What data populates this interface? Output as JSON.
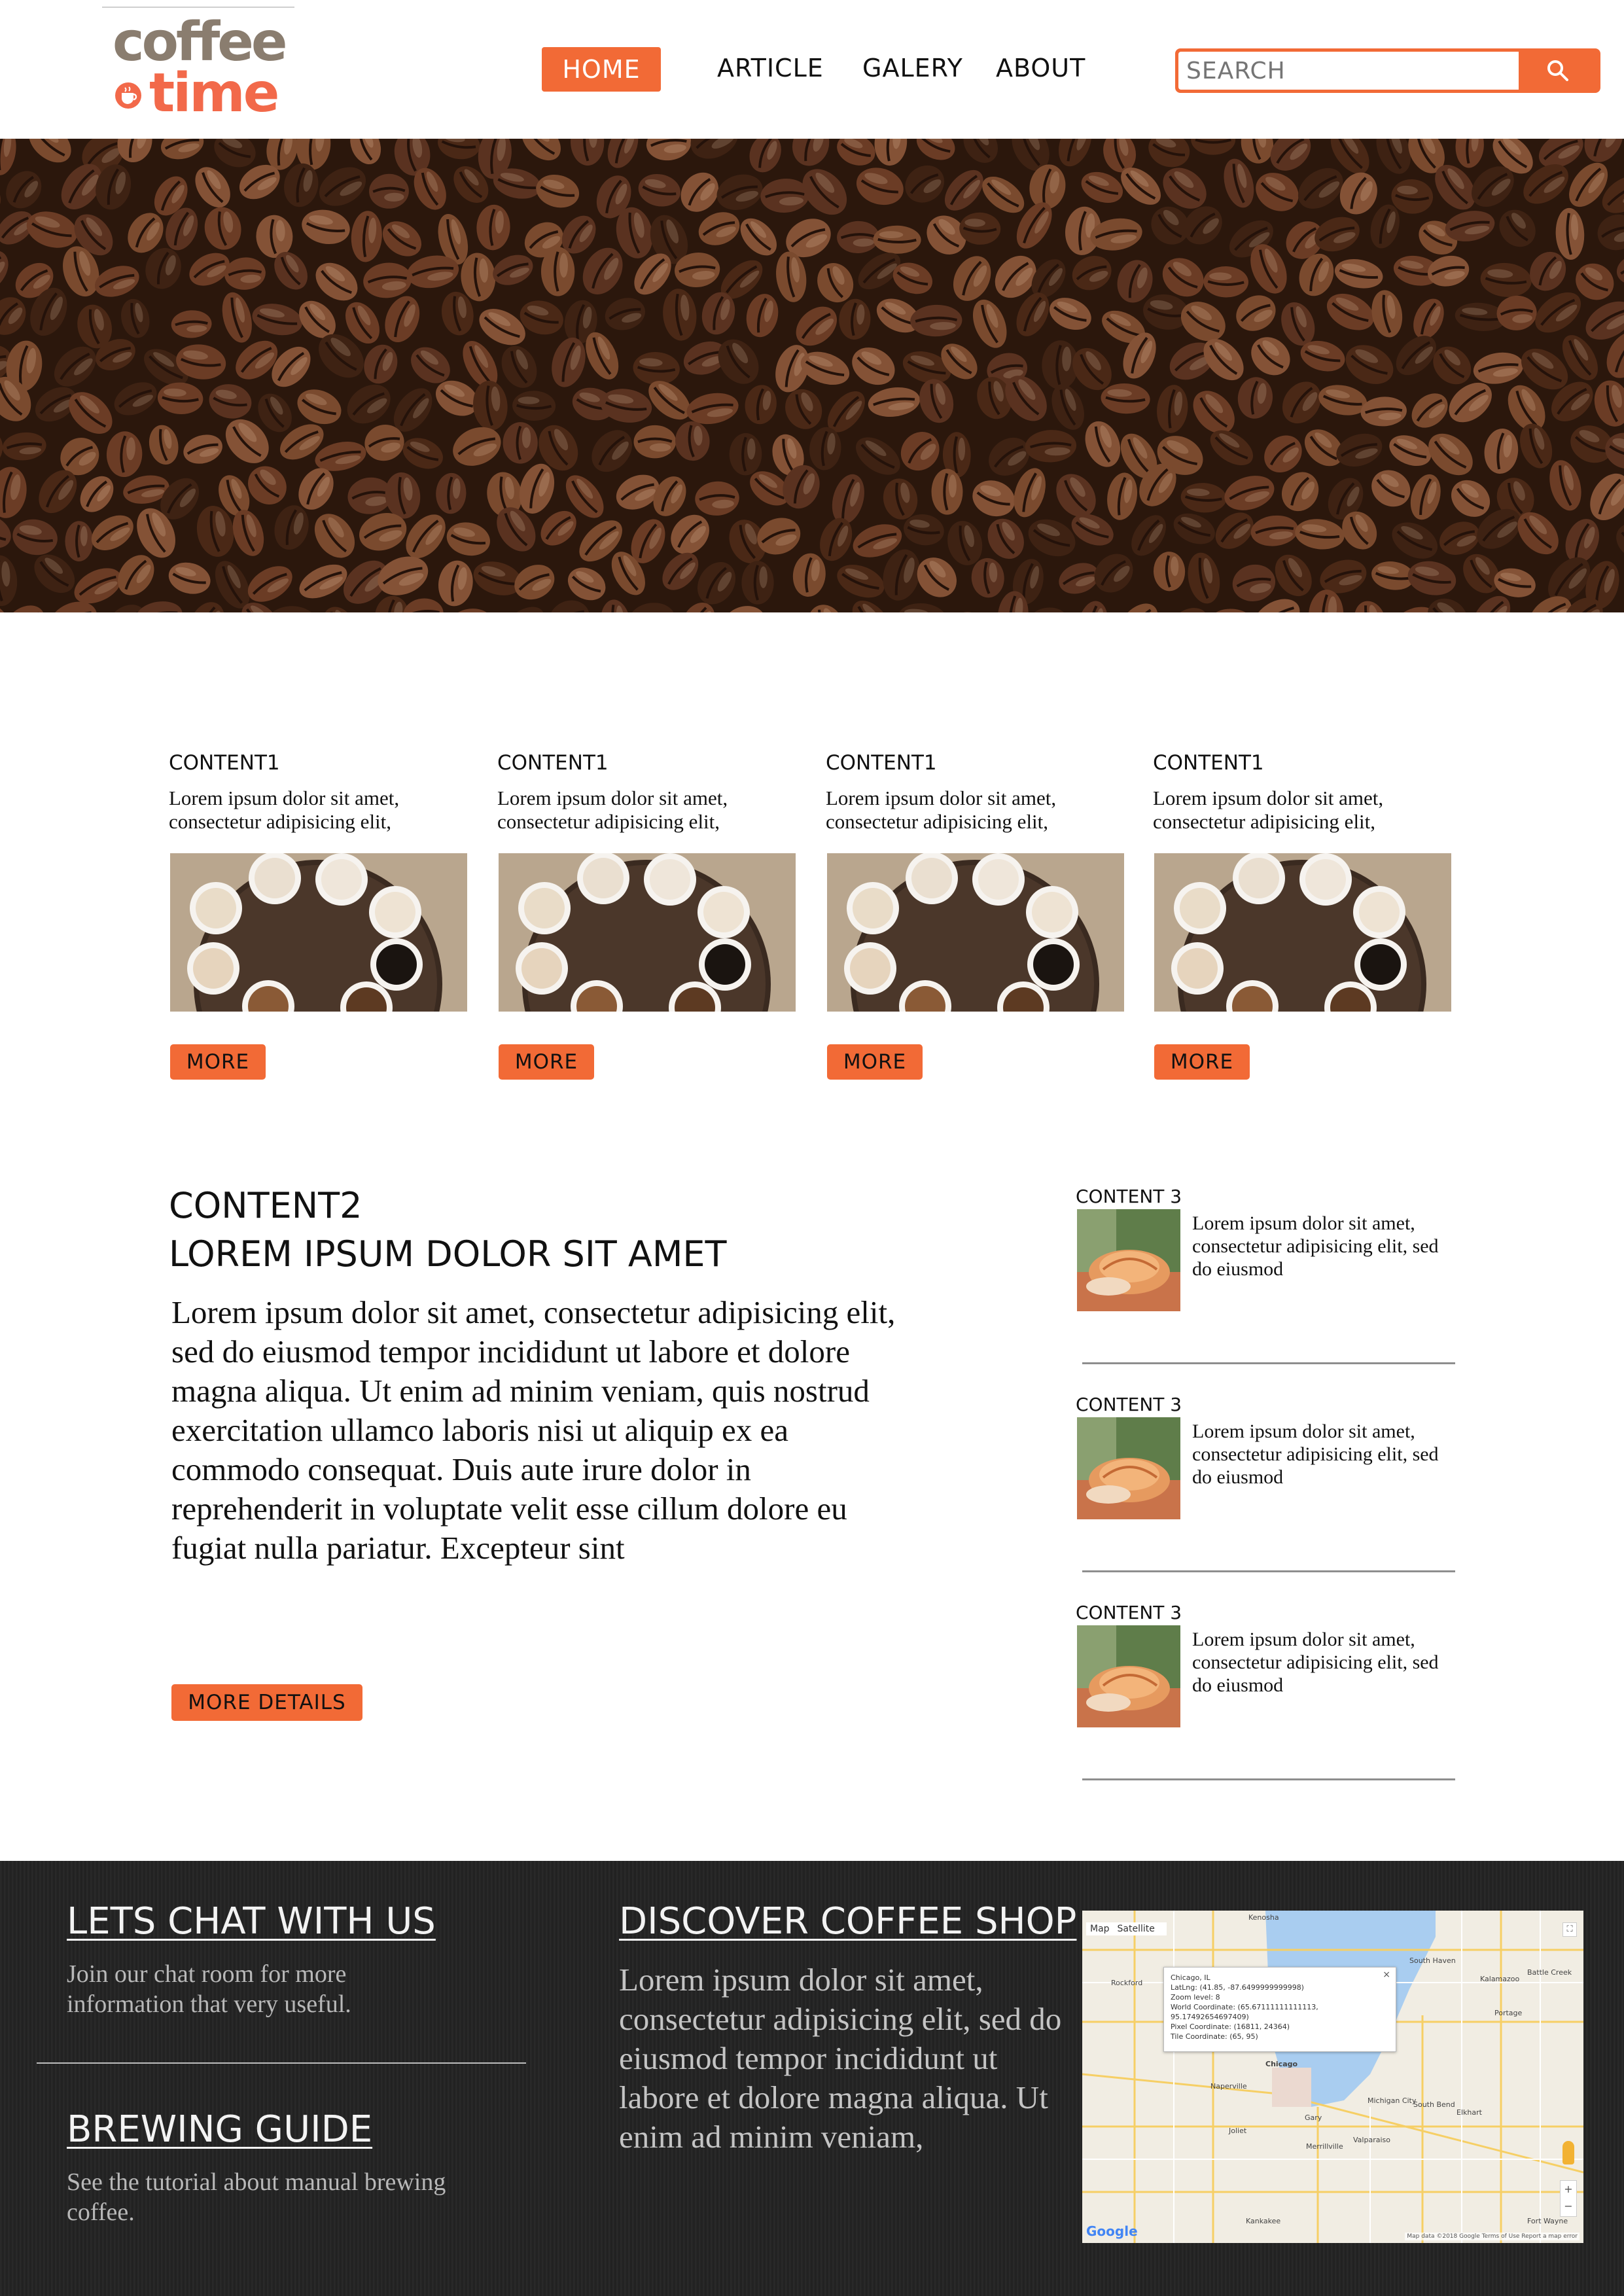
{
  "logo": {
    "word1": "coffee",
    "word2": "time"
  },
  "nav": {
    "home": "HOME",
    "article": "ARTICLE",
    "galery": "GALERY",
    "about": "ABOUT"
  },
  "search": {
    "placeholder": "SEARCH"
  },
  "colors": {
    "accent": "#f26a36",
    "footer_bg": "#242424",
    "logo_brown": "#8a7d6f",
    "logo_orange": "#f2694a"
  },
  "content1": {
    "cards": [
      {
        "title": "CONTENT1",
        "text": "Lorem ipsum dolor sit amet, consectetur adipisicing elit,",
        "button": "MORE"
      },
      {
        "title": "CONTENT1",
        "text": "Lorem ipsum dolor sit amet, consectetur adipisicing elit,",
        "button": "MORE"
      },
      {
        "title": "CONTENT1",
        "text": "Lorem ipsum dolor sit amet, consectetur adipisicing elit,",
        "button": "MORE"
      },
      {
        "title": "CONTENT1",
        "text": "Lorem ipsum dolor sit amet, consectetur adipisicing elit,",
        "button": "MORE"
      }
    ]
  },
  "content2": {
    "title_line1": "CONTENT2",
    "title_line2": "LOREM IPSUM DOLOR SIT AMET",
    "body": "Lorem ipsum dolor sit amet, consectetur adipisicing elit, sed do eiusmod tempor incididunt ut labore et dolore magna aliqua. Ut enim ad minim veniam, quis nostrud exercitation ullamco laboris nisi ut aliquip ex ea commodo consequat. Duis aute irure dolor in reprehenderit in voluptate velit esse cillum dolore eu fugiat nulla pariatur. Excepteur sint",
    "button": "MORE DETAILS"
  },
  "content3": {
    "items": [
      {
        "title": "CONTENT 3",
        "text": "Lorem ipsum dolor sit amet, consectetur adipisicing  elit, sed do eiusmod"
      },
      {
        "title": "CONTENT 3",
        "text": "Lorem ipsum dolor sit amet, consectetur adipisicing  elit, sed do eiusmod"
      },
      {
        "title": "CONTENT 3",
        "text": "Lorem ipsum dolor sit amet, consectetur adipisicing  elit, sed do eiusmod"
      }
    ]
  },
  "footer": {
    "chat": {
      "title": "LETS CHAT WITH US",
      "text": "Join our chat room for more information that very useful."
    },
    "guide": {
      "title": "BREWING GUIDE",
      "text": "See the tutorial about manual brewing coffee."
    },
    "discover": {
      "title": "DISCOVER COFFEE SHOP",
      "text": "Lorem ipsum dolor sit amet, consectetur adipisicing elit, sed do eiusmod tempor incididunt ut labore et dolore magna aliqua. Ut enim ad minim veniam,"
    },
    "map": {
      "type_map": "Map",
      "type_satellite": "Satellite",
      "popup": [
        "Chicago, IL",
        "LatLng: (41.85, -87.6499999999998)",
        "Zoom level: 8",
        "World Coordinate: (65.67111111111113, 95.17492654697409)",
        "Pixel Coordinate: (16811, 24364)",
        "Tile Coordinate: (65, 95)"
      ],
      "close": "×",
      "labels": [
        "Kenosha",
        "Rockford",
        "Naperville",
        "Chicago",
        "Joliet",
        "Gary",
        "South Bend",
        "Kalamazoo",
        "Battle Creek",
        "Elkhart",
        "Kankakee",
        "Fort Wayne",
        "Michigan City",
        "South Haven",
        "Portage",
        "Merrillville",
        "Valparaiso"
      ],
      "google": "Google",
      "attribution": "Map data ©2018 Google   Terms of Use   Report a map error"
    }
  }
}
